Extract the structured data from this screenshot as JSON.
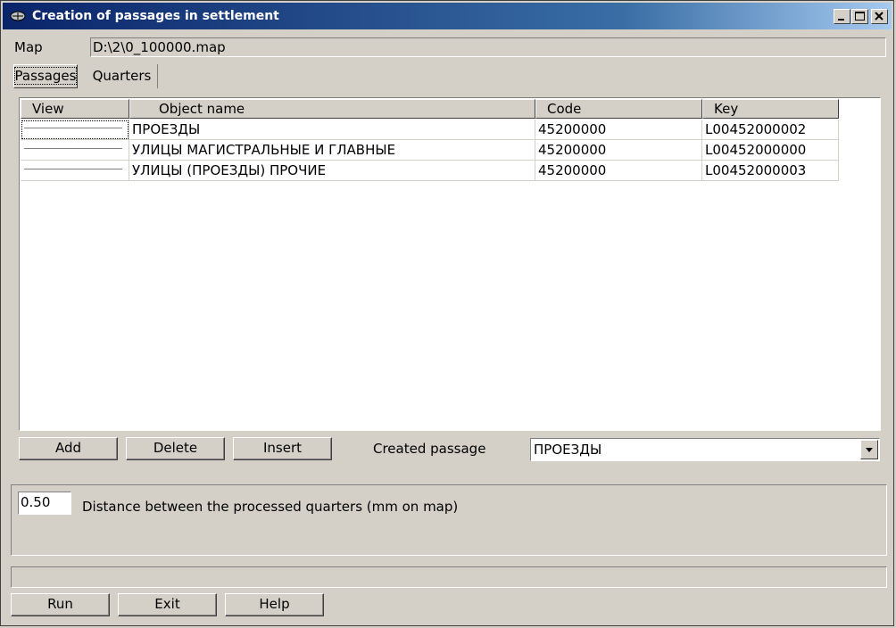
{
  "window": {
    "title": "Creation of passages in settlement"
  },
  "map": {
    "label": "Map",
    "path": "D:\\2\\0_100000.map"
  },
  "tabs": [
    {
      "label": "Passages"
    },
    {
      "label": "Quarters"
    }
  ],
  "table": {
    "columns": [
      "View",
      "Object name",
      "Code",
      "Key"
    ],
    "rows": [
      {
        "name": "ПРОЕЗДЫ",
        "code": "45200000",
        "key": "L00452000002"
      },
      {
        "name": "УЛИЦЫ МАГИСТРАЛЬНЫЕ И ГЛАВНЫЕ",
        "code": "45200000",
        "key": "L00452000000"
      },
      {
        "name": "УЛИЦЫ (ПРОЕЗДЫ) ПРОЧИЕ",
        "code": "45200000",
        "key": "L00452000003"
      }
    ]
  },
  "buttons": {
    "add": "Add",
    "delete": "Delete",
    "insert": "Insert",
    "run": "Run",
    "exit": "Exit",
    "help": "Help"
  },
  "created_passage": {
    "label": "Created passage",
    "value": "ПРОЕЗДЫ"
  },
  "distance": {
    "value": "0.50",
    "label": "Distance between the processed quarters (mm on map)"
  },
  "status_text": "",
  "colors": {
    "title_start": "#0a246a",
    "title_end": "#a6caf0",
    "face": "#d4d0c8"
  }
}
